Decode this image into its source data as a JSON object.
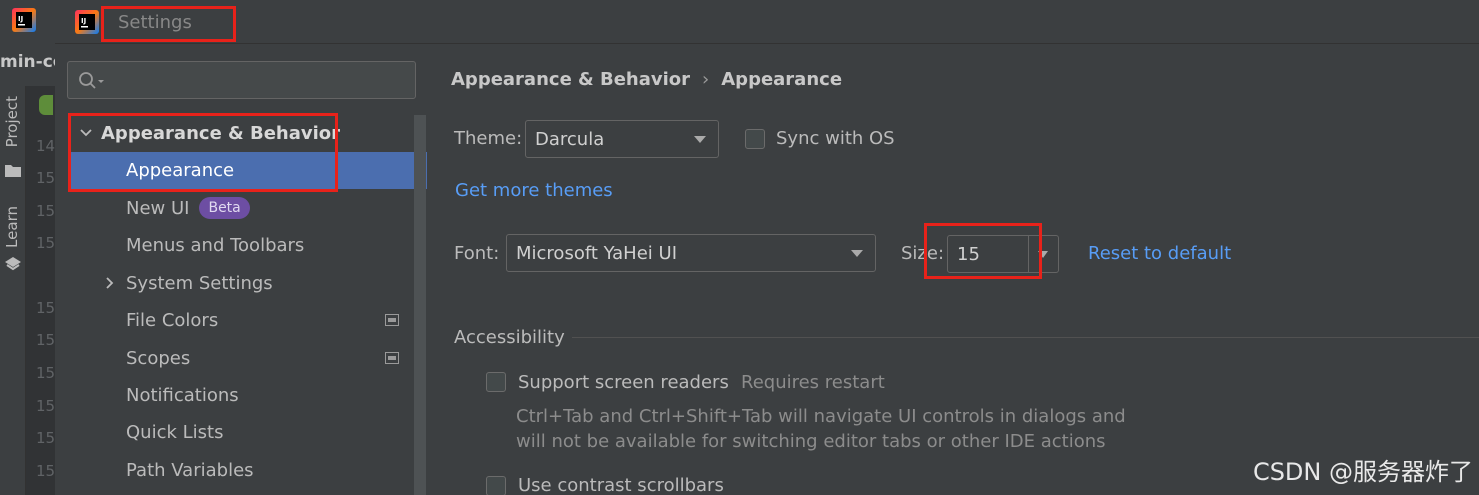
{
  "ide": {
    "project_name": "min-co",
    "tool_tabs": [
      "Project",
      "Learn"
    ],
    "gutter_lines": [
      "14",
      "15",
      "15",
      "15",
      "15",
      "15",
      "15",
      "15",
      "15",
      "15",
      "15"
    ]
  },
  "dialog": {
    "title": "Settings"
  },
  "sidebar": {
    "search_placeholder": "",
    "group_label": "Appearance & Behavior",
    "items": [
      {
        "label": "Appearance",
        "selected": true
      },
      {
        "label": "New UI",
        "badge": "Beta"
      },
      {
        "label": "Menus and Toolbars"
      },
      {
        "label": "System Settings",
        "expandable": true
      },
      {
        "label": "File Colors",
        "project_icon": true
      },
      {
        "label": "Scopes",
        "project_icon": true
      },
      {
        "label": "Notifications"
      },
      {
        "label": "Quick Lists"
      },
      {
        "label": "Path Variables"
      }
    ]
  },
  "content": {
    "breadcrumb": [
      "Appearance & Behavior",
      "Appearance"
    ],
    "theme_label": "Theme:",
    "theme_value": "Darcula",
    "sync_os_label": "Sync with OS",
    "get_more_themes": "Get more themes",
    "font_label": "Font:",
    "font_value": "Microsoft YaHei UI",
    "size_label": "Size:",
    "size_value": "15",
    "reset_label": "Reset to default",
    "accessibility_title": "Accessibility",
    "screen_readers_label": "Support screen readers",
    "requires_restart": "Requires restart",
    "screen_readers_hint_1": "Ctrl+Tab and Ctrl+Shift+Tab will navigate UI controls in dialogs and",
    "screen_readers_hint_2": "will not be available for switching editor tabs or other IDE actions",
    "contrast_scrollbars_label": "Use contrast scrollbars"
  },
  "watermark": "CSDN @服务器炸了",
  "colors": {
    "background": "#3c3f41",
    "selection": "#4b6eaf",
    "link": "#589df6",
    "highlight_box": "#e8221a",
    "beta_badge": "#6d4ea3"
  }
}
